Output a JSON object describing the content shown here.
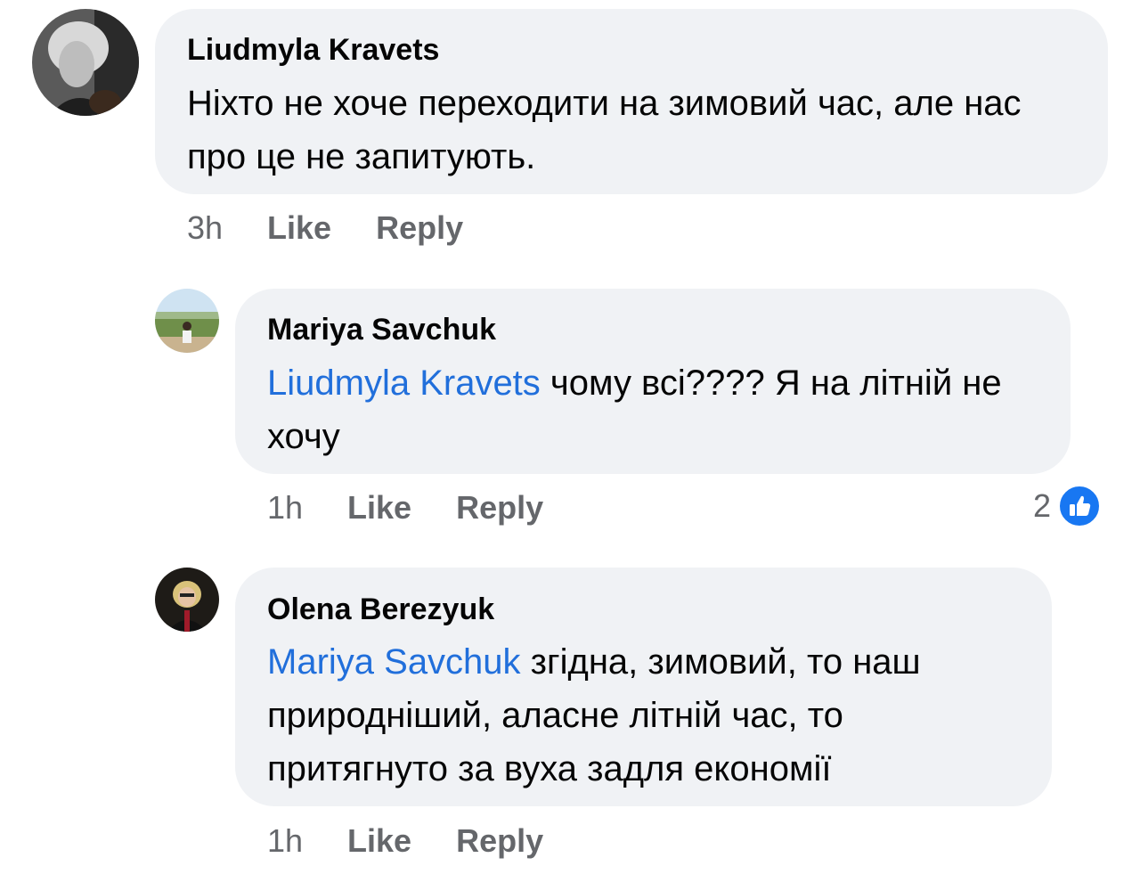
{
  "comments": [
    {
      "author": "Liudmyla Kravets",
      "mention": "",
      "text": "Ніхто не хоче переходити на зимовий час, але нас про це не запитують.",
      "time": "3h",
      "like_label": "Like",
      "reply_label": "Reply"
    },
    {
      "author": "Mariya Savchuk",
      "mention": "Liudmyla Kravets",
      "text": " чому всі???? Я на літній не хочу",
      "time": "1h",
      "like_label": "Like",
      "reply_label": "Reply",
      "reaction_count": "2",
      "reaction_icon": "thumbs-up-icon"
    },
    {
      "author": "Olena Berezyuk",
      "mention": "Mariya Savchuk",
      "text": " згідна, зимовий, то наш природніший, аласне літній час, то притягнуто за вуха задля економії",
      "time": "1h",
      "like_label": "Like",
      "reply_label": "Reply"
    }
  ],
  "colors": {
    "bubble": "#f0f2f5",
    "mention": "#216fdb",
    "meta": "#65676b",
    "like_badge": "#1877f2"
  }
}
